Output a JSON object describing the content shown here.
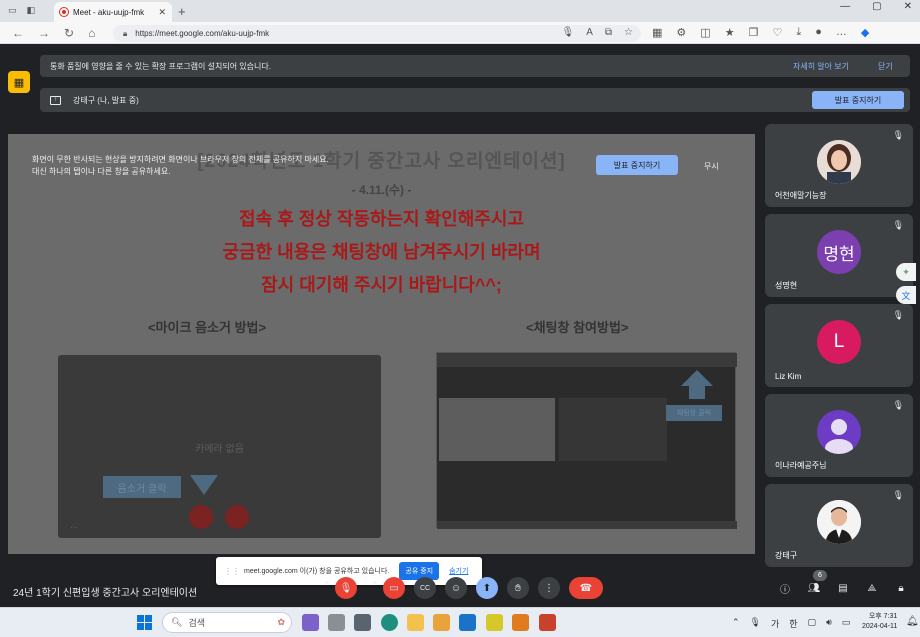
{
  "browser": {
    "tab_title": "Meet - aku-uujp-fmk",
    "url": "https://meet.google.com/aku-uujp-fmk"
  },
  "banners": {
    "ext_warning": "통화 품질에 영향을 줄 수 있는 확장 프로그램이 설치되어 있습니다.",
    "learn_more": "자세히 알아 보기",
    "close": "닫기",
    "presenter": "강태구 (나, 발표 중)",
    "stop_presenting": "발표 중지하기"
  },
  "overlay": {
    "line1": "화면이 무한 반사되는 현상을 방지하려면 화면이나 브라우저 창의 전체를 공유하지 마세요.",
    "line2": "대신 하나의 탭이나 다른 창을 공유하세요.",
    "stop_button": "발표 중지하기",
    "ignore": "무시"
  },
  "slide": {
    "title": "[2024학년도 1학기 중간고사 오리엔테이션]",
    "date": "- 4.11.(수) -",
    "red_lines": [
      "접속 후 정상 작동하는지 확인해주시고",
      "궁금한 내용은 채팅창에 남겨주시기 바라며",
      "잠시 대기해 주시기 바랍니다^^;"
    ],
    "left_heading": "<마이크 음소거 방법>",
    "right_heading": "<채팅창 참여방법>",
    "no_camera": "카메라 없음",
    "mute_click": "음소거 클릭",
    "chat_click": "채팅창 클릭"
  },
  "participants": [
    {
      "name": "어천애말기능장",
      "avatar_type": "photo",
      "color": "#c9a99a"
    },
    {
      "name": "성명현",
      "avatar_type": "initial",
      "initial": "명현",
      "color": "#7b3fb0"
    },
    {
      "name": "Liz Kim",
      "avatar_type": "initial",
      "initial": "L",
      "color": "#d81b60"
    },
    {
      "name": "이나라예공주님",
      "avatar_type": "placeholder",
      "color": "#6d3cc4"
    },
    {
      "name": "강태구",
      "avatar_type": "photo",
      "color": "#e9e9e9"
    }
  ],
  "share_notice": {
    "text": "meet.google.com 이(가) 창을 공유하고 있습니다.",
    "stop": "공유 중지",
    "hide": "숨기기"
  },
  "meeting_title": "24년 1학기 신편입생 중간고사 오리엔테이션",
  "participant_count": "6",
  "taskbar": {
    "search_placeholder": "검색",
    "ime_1": "가",
    "ime_2": "한",
    "time": "오후 7:31",
    "date": "2024-04-11"
  }
}
